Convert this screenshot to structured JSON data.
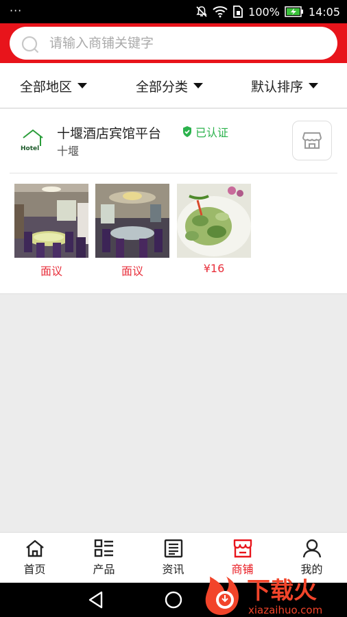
{
  "status": {
    "dots": "···",
    "battery": "100%",
    "time": "14:05"
  },
  "search": {
    "placeholder": "请输入商铺关键字"
  },
  "filters": [
    {
      "label": "全部地区"
    },
    {
      "label": "全部分类"
    },
    {
      "label": "默认排序"
    }
  ],
  "shop": {
    "logo_text": "Hotel",
    "name": "十堰酒店宾馆平台",
    "verified": "已认证",
    "city": "十堰",
    "products": [
      {
        "price": "面议",
        "image": "banquet room round tables"
      },
      {
        "price": "面议",
        "image": "private dining room chandelier"
      },
      {
        "price": "¥16",
        "image": "cucumber salad with cilantro"
      }
    ]
  },
  "tabs": [
    {
      "label": "首页",
      "icon": "home-icon",
      "active": false
    },
    {
      "label": "产品",
      "icon": "list-icon",
      "active": false
    },
    {
      "label": "资讯",
      "icon": "news-icon",
      "active": false
    },
    {
      "label": "商铺",
      "icon": "shop-icon",
      "active": true
    },
    {
      "label": "我的",
      "icon": "user-icon",
      "active": false
    }
  ],
  "watermark": {
    "title": "下载火",
    "url": "xiazaihuo.com"
  },
  "colors": {
    "brand": "#e8141b",
    "verified": "#2bb24c",
    "price": "#e8303c"
  }
}
